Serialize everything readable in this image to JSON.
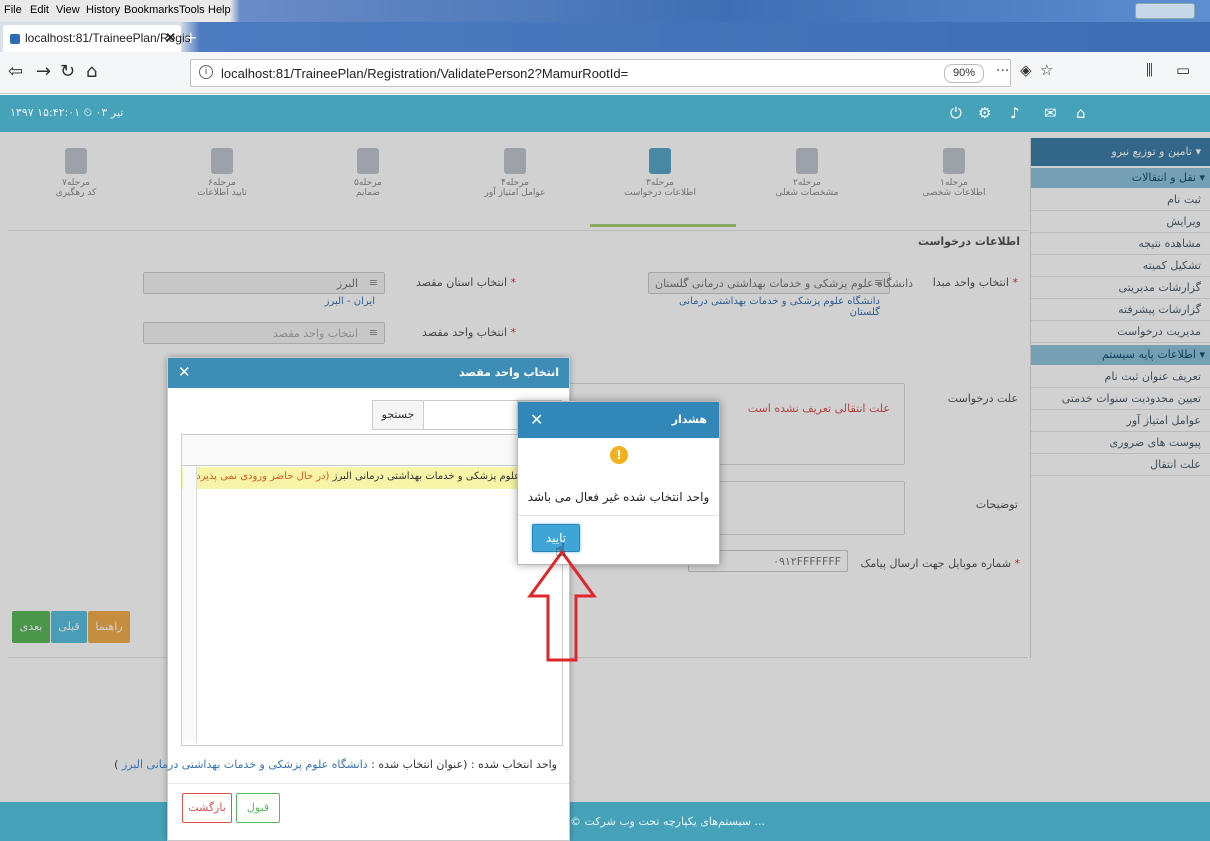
{
  "browser": {
    "menu": [
      "File",
      "Edit",
      "View",
      "History",
      "Bookmarks",
      "Tools",
      "Help"
    ],
    "tab_title": "localhost:81/TraineePlan/Regis",
    "url": "localhost:81/TraineePlan/Registration/ValidatePerson2?MamurRootId=",
    "zoom": "90%",
    "more": "···"
  },
  "app": {
    "datetime": "۱۳۹۷ تیر ۰۳ ⏲ ۱۵:۴۲:۰۱",
    "footer": "© سیستم‌های یکپارچه تحت وب شرکت ..."
  },
  "sidebar": {
    "header": "تامین و توزیع نیرو ▾",
    "section1": "نقل و انتقالات ▾",
    "items1": [
      "ثبت نام",
      "ویرایش",
      "مشاهده نتیجه",
      "تشکیل کمیته",
      "گزارشات مدیریتی",
      "گزارشات پیشرفته",
      "مدیریت درخواست"
    ],
    "section2": "اطلاعات پایه سیستم ▾",
    "items2": [
      "تعریف عنوان ثبت نام",
      "تعیین محدودیت سنوات خدمتی",
      "عوامل امتیاز آور",
      "پیوست های ضروری",
      "علت انتقال"
    ]
  },
  "steps": [
    {
      "num": "مرحله۱",
      "label": "اطلاعات شخصی"
    },
    {
      "num": "مرحله۲",
      "label": "مشخصات شغلی"
    },
    {
      "num": "مرحله۳",
      "label": "اطلاعات درخواست"
    },
    {
      "num": "مرحله۴",
      "label": "عوامل امتیاز آور"
    },
    {
      "num": "مرحله۵",
      "label": "ضمایم"
    },
    {
      "num": "مرحله۶",
      "label": "تایید اطلاعات"
    },
    {
      "num": "مرحله۷",
      "label": "کد رهگیری"
    }
  ],
  "form": {
    "section_title": "اطلاعات درخواست",
    "origin_label": "انتخاب واحد مبدا",
    "origin_value": "دانشگاه علوم پزشکی و خدمات بهداشتی درمانی گلستان",
    "origin_link": "دانشگاه علوم پزشکی و خدمات بهداشتی درمانی گلستان",
    "province_label": "انتخاب استان مقصد",
    "province_value": "البرز",
    "province_link": "ایران - البرز",
    "dest_label": "انتخاب واحد مقصد",
    "dest_placeholder": "انتخاب واحد مقصد",
    "reason_label": "علت درخواست",
    "reason_text": "علت انتقالی تعریف نشده است",
    "desc_label": "توضیحات",
    "mobile_label": "شماره موبایل جهت ارسال پیامک",
    "mobile_value": "۰۹۱۲FFFFFFF",
    "btn_help": "راهنما",
    "btn_prev": "قبلی",
    "btn_next": "بعدی"
  },
  "dialog": {
    "title": "انتخاب واحد مقصد",
    "search_placeholder": "واحد ...",
    "search_btn": "جستجو",
    "col_header": "واحد",
    "row_text": "دانشگاه علوم پزشکی و خدمات بهداشتی درمانی البرز",
    "row_sub": "(در حال حاضر ورودی نمی پذیرد)",
    "selected_prefix": "واحد انتخاب شده : (عنوان انتخاب شده :",
    "selected_value": "دانشگاه علوم پزشکی و خدمات بهداشتی درمانی البرز",
    "selected_suffix": ")",
    "accept": "قبول",
    "back": "بازگشت"
  },
  "warning": {
    "title": "هشدار",
    "message": "واحد انتخاب شده غیر فعال می باشد",
    "ok": "تایید"
  },
  "colors": {
    "topbar": "#46a2b9",
    "accent": "#3e8db7",
    "warn": "#f2b01e",
    "arrow": "#e0262b"
  }
}
